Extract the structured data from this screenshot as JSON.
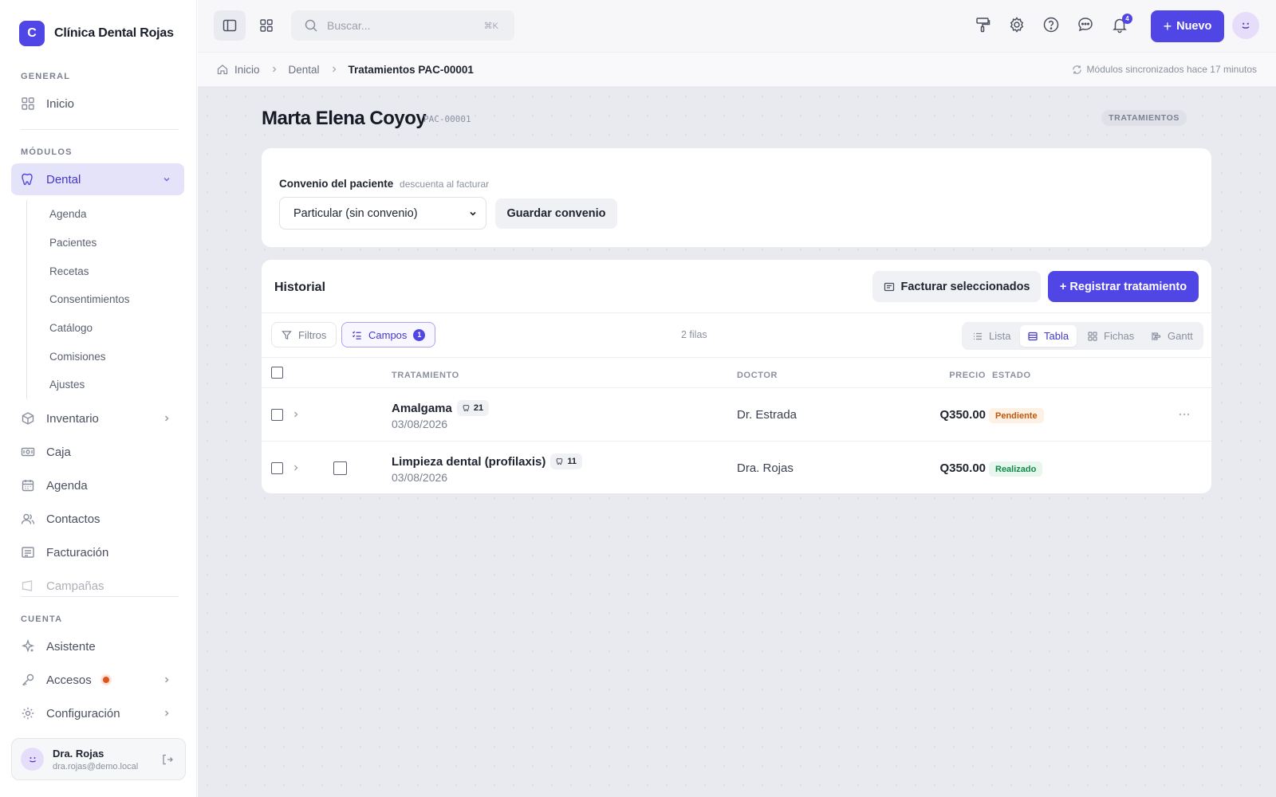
{
  "brand": {
    "initial": "C",
    "name": "Clínica Dental Rojas",
    "color": "#4f46e5"
  },
  "sidebar": {
    "general_label": "GENERAL",
    "modules_label": "MÓDULOS",
    "account_label": "CUENTA",
    "inicio": "Inicio",
    "dental": "Dental",
    "dental_sub": [
      "Agenda",
      "Pacientes",
      "Recetas",
      "Consentimientos",
      "Catálogo",
      "Comisiones",
      "Ajustes"
    ],
    "modules": [
      "Inventario",
      "Caja",
      "Agenda",
      "Contactos",
      "Facturación",
      "Campañas"
    ],
    "account": [
      "Asistente",
      "Accesos",
      "Configuración"
    ]
  },
  "user": {
    "name": "Dra. Rojas",
    "email": "dra.rojas@demo.local"
  },
  "topbar": {
    "search_placeholder": "Buscar...",
    "search_shortcut": "⌘K",
    "notifications_count": "4",
    "new_label": "Nuevo"
  },
  "breadcrumb": {
    "items": [
      "Inicio",
      "Dental",
      "Tratamientos PAC-00001"
    ],
    "sync_status": "Módulos sincronizados hace 17 minutos"
  },
  "patient": {
    "name": "Marta Elena Coyoy",
    "code": "PAC-00001",
    "section_tag": "TRATAMIENTOS"
  },
  "convenio": {
    "label": "Convenio del paciente",
    "hint": "descuenta al facturar",
    "selected": "Particular (sin convenio)",
    "save_label": "Guardar convenio"
  },
  "history": {
    "title": "Historial",
    "invoice_label": "Facturar seleccionados",
    "register_label": "+ Registrar tratamiento",
    "filters_label": "Filtros",
    "fields_label": "Campos",
    "fields_count": "1",
    "row_count": "2 filas",
    "views": [
      "Lista",
      "Tabla",
      "Fichas",
      "Gantt"
    ],
    "active_view": "Tabla",
    "columns": {
      "treatment": "TRATAMIENTO",
      "doctor": "DOCTOR",
      "price": "PRECIO",
      "status": "ESTADO"
    },
    "rows": [
      {
        "treatment": "Amalgama",
        "tooth": "21",
        "date": "03/08/2026",
        "doctor": "Dr. Estrada",
        "price": "Q350.00",
        "status": "Pendiente"
      },
      {
        "treatment": "Limpieza dental (profilaxis)",
        "tooth": "11",
        "date": "03/08/2026",
        "doctor": "Dra. Rojas",
        "price": "Q350.00",
        "status": "Realizado"
      }
    ]
  },
  "colors": {
    "accent": "#4f46e5",
    "pending": "#c2560c",
    "done": "#128a4a"
  }
}
